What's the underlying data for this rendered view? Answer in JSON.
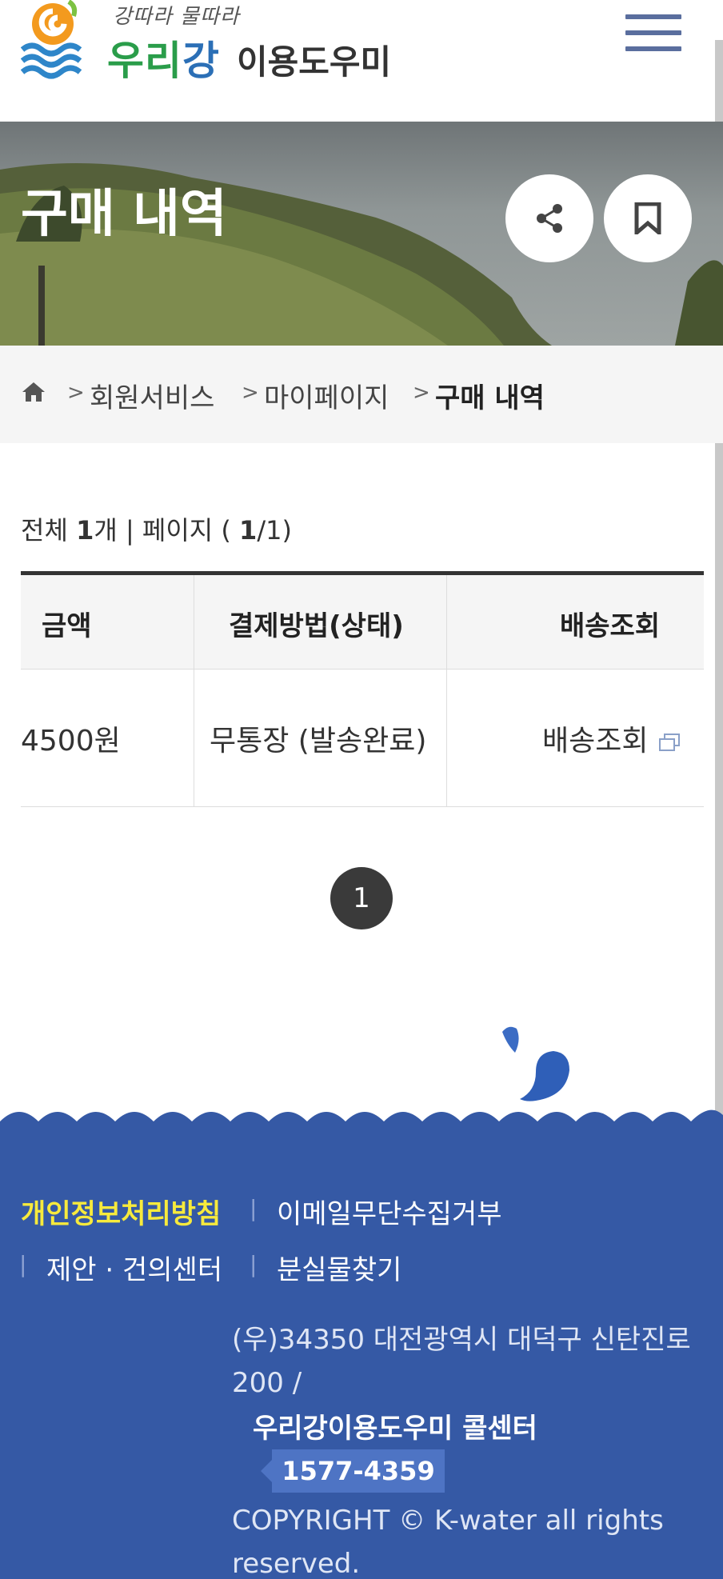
{
  "header": {
    "logo": {
      "tagline": "강따라 물따라",
      "name_green": "우리",
      "name_blue": "강",
      "subtitle": "이용도우미"
    },
    "menu_icon": "hamburger-menu-icon"
  },
  "banner": {
    "title": "구매 내역",
    "share_icon": "share-icon",
    "bookmark_icon": "bookmark-icon"
  },
  "breadcrumb": {
    "home_icon": "home-icon",
    "items": [
      "회원서비스",
      "마이페이지",
      "구매 내역"
    ]
  },
  "summary": {
    "total_label": "전체",
    "total_count": "1",
    "total_unit": "개 | 페이지 (",
    "current_page": "1",
    "page_suffix": "/1)"
  },
  "table": {
    "headers": [
      "금액",
      "결제방법(상태)",
      "배송조회"
    ],
    "rows": [
      {
        "amount": "4500원",
        "payment": "무통장 (발송완료)",
        "tracking": "배송조회"
      }
    ]
  },
  "pagination": {
    "current": "1"
  },
  "footer": {
    "links": [
      "개인정보처리방침",
      "이메일무단수집거부",
      "제안 · 건의센터",
      "분실물찾기"
    ],
    "address": "(우)34350 대전광역시 대덕구 신탄진로 200 /",
    "callcenter_label": "우리강이용도우미 콜센터",
    "phone": "1577-4359",
    "copyright": "COPYRIGHT © K-water all rights reserved.",
    "accent_color": "#f7ea3c",
    "background_color": "#3559a5"
  }
}
